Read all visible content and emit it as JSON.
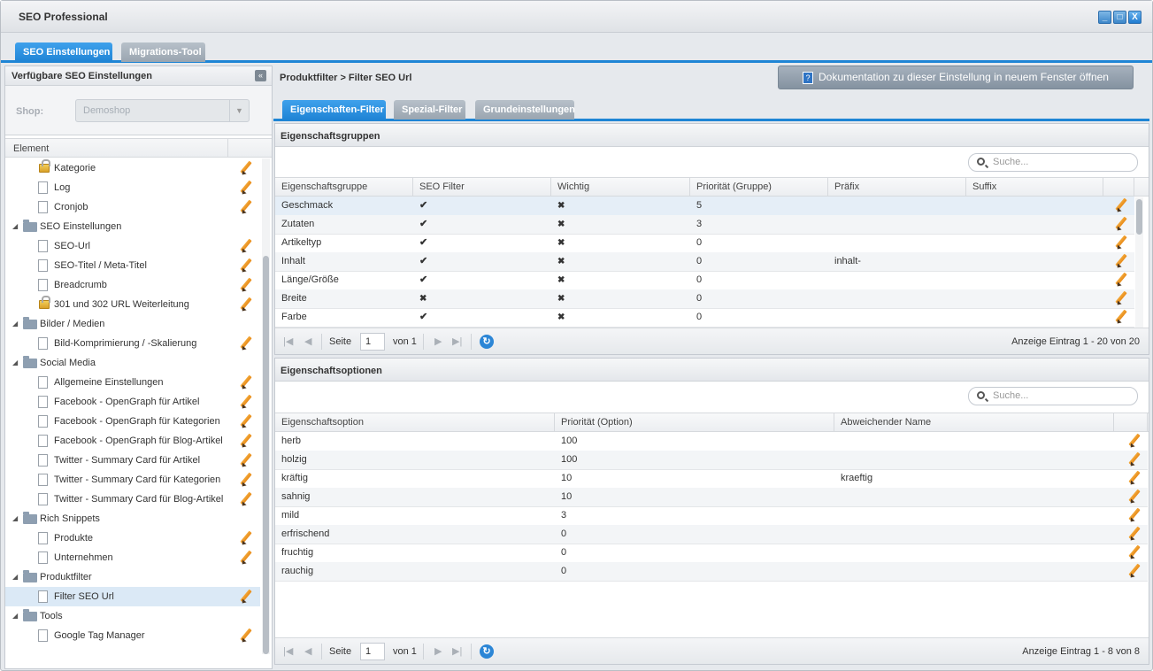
{
  "window": {
    "title": "SEO Professional"
  },
  "main_tabs": [
    {
      "label": "SEO Einstellungen",
      "active": true
    },
    {
      "label": "Migrations-Tool",
      "active": false
    }
  ],
  "left_panel": {
    "title": "Verfügbare SEO Einstellungen",
    "shop_label": "Shop:",
    "shop_value": "Demoshop",
    "tree_header": "Element",
    "tree": [
      {
        "label": "Kategorie",
        "type": "lock",
        "level": 1,
        "editable": true
      },
      {
        "label": "Log",
        "type": "doc",
        "level": 1,
        "editable": true
      },
      {
        "label": "Cronjob",
        "type": "doc",
        "level": 1,
        "editable": true
      },
      {
        "label": "SEO Einstellungen",
        "type": "folder",
        "level": 0,
        "editable": false
      },
      {
        "label": "SEO-Url",
        "type": "doc",
        "level": 1,
        "editable": true
      },
      {
        "label": "SEO-Titel / Meta-Titel",
        "type": "doc",
        "level": 1,
        "editable": true
      },
      {
        "label": "Breadcrumb",
        "type": "doc",
        "level": 1,
        "editable": true
      },
      {
        "label": "301 und 302 URL Weiterleitung",
        "type": "lock",
        "level": 1,
        "editable": true
      },
      {
        "label": "Bilder / Medien",
        "type": "folder",
        "level": 0,
        "editable": false
      },
      {
        "label": "Bild-Komprimierung / -Skalierung",
        "type": "doc",
        "level": 1,
        "editable": true
      },
      {
        "label": "Social Media",
        "type": "folder",
        "level": 0,
        "editable": false
      },
      {
        "label": "Allgemeine Einstellungen",
        "type": "doc",
        "level": 1,
        "editable": true
      },
      {
        "label": "Facebook - OpenGraph für Artikel",
        "type": "doc",
        "level": 1,
        "editable": true
      },
      {
        "label": "Facebook - OpenGraph für Kategorien",
        "type": "doc",
        "level": 1,
        "editable": true
      },
      {
        "label": "Facebook - OpenGraph für Blog-Artikel",
        "type": "doc",
        "level": 1,
        "editable": true
      },
      {
        "label": "Twitter - Summary Card für Artikel",
        "type": "doc",
        "level": 1,
        "editable": true
      },
      {
        "label": "Twitter - Summary Card für Kategorien",
        "type": "doc",
        "level": 1,
        "editable": true
      },
      {
        "label": "Twitter - Summary Card für Blog-Artikel",
        "type": "doc",
        "level": 1,
        "editable": true
      },
      {
        "label": "Rich Snippets",
        "type": "folder",
        "level": 0,
        "editable": false
      },
      {
        "label": "Produkte",
        "type": "doc",
        "level": 1,
        "editable": true
      },
      {
        "label": "Unternehmen",
        "type": "doc",
        "level": 1,
        "editable": true
      },
      {
        "label": "Produktfilter",
        "type": "folder",
        "level": 0,
        "editable": false
      },
      {
        "label": "Filter SEO Url",
        "type": "doc",
        "level": 1,
        "editable": true,
        "selected": true
      },
      {
        "label": "Tools",
        "type": "folder",
        "level": 0,
        "editable": false
      },
      {
        "label": "Google Tag Manager",
        "type": "doc",
        "level": 1,
        "editable": true
      }
    ]
  },
  "right_panel": {
    "breadcrumb": "Produktfilter > Filter SEO Url",
    "doc_button": "Dokumentation zu dieser Einstellung in neuem Fenster öffnen",
    "sub_tabs": [
      {
        "label": "Eigenschaften-Filter",
        "active": true
      },
      {
        "label": "Spezial-Filter",
        "active": false
      },
      {
        "label": "Grundeinstellungen",
        "active": false
      }
    ]
  },
  "groups": {
    "title": "Eigenschaftsgruppen",
    "search_placeholder": "Suche...",
    "columns": [
      "Eigenschaftsgruppe",
      "SEO Filter",
      "Wichtig",
      "Priorität (Gruppe)",
      "Präfix",
      "Suffix"
    ],
    "rows": [
      {
        "name": "Geschmack",
        "seo": true,
        "wichtig": false,
        "prio": "5",
        "prefix": "",
        "suffix": ""
      },
      {
        "name": "Zutaten",
        "seo": true,
        "wichtig": false,
        "prio": "3",
        "prefix": "",
        "suffix": ""
      },
      {
        "name": "Artikeltyp",
        "seo": true,
        "wichtig": false,
        "prio": "0",
        "prefix": "",
        "suffix": ""
      },
      {
        "name": "Inhalt",
        "seo": true,
        "wichtig": false,
        "prio": "0",
        "prefix": "inhalt-",
        "suffix": ""
      },
      {
        "name": "Länge/Größe",
        "seo": true,
        "wichtig": false,
        "prio": "0",
        "prefix": "",
        "suffix": ""
      },
      {
        "name": "Breite",
        "seo": false,
        "wichtig": false,
        "prio": "0",
        "prefix": "",
        "suffix": ""
      },
      {
        "name": "Farbe",
        "seo": true,
        "wichtig": false,
        "prio": "0",
        "prefix": "",
        "suffix": ""
      }
    ],
    "pager": {
      "page_label": "Seite",
      "page": "1",
      "of_label": "von 1",
      "info": "Anzeige Eintrag 1 - 20 von 20"
    }
  },
  "options": {
    "title": "Eigenschaftsoptionen",
    "search_placeholder": "Suche...",
    "columns": [
      "Eigenschaftsoption",
      "Priorität (Option)",
      "Abweichender Name"
    ],
    "rows": [
      {
        "name": "herb",
        "prio": "100",
        "alt": ""
      },
      {
        "name": "holzig",
        "prio": "100",
        "alt": ""
      },
      {
        "name": "kräftig",
        "prio": "10",
        "alt": "kraeftig"
      },
      {
        "name": "sahnig",
        "prio": "10",
        "alt": ""
      },
      {
        "name": "mild",
        "prio": "3",
        "alt": ""
      },
      {
        "name": "erfrischend",
        "prio": "0",
        "alt": ""
      },
      {
        "name": "fruchtig",
        "prio": "0",
        "alt": ""
      },
      {
        "name": "rauchig",
        "prio": "0",
        "alt": ""
      }
    ],
    "pager": {
      "page_label": "Seite",
      "page": "1",
      "of_label": "von 1",
      "info": "Anzeige Eintrag 1 - 8 von 8"
    }
  },
  "icons": {
    "check": "✔",
    "cross": "✖",
    "refresh": "↻",
    "first": "|◀",
    "prev": "◀",
    "next": "▶",
    "last": "▶|",
    "collapse": "«",
    "minimize": "_",
    "maximize": "□",
    "close": "X",
    "help": "?",
    "dropdown": "▼",
    "tree_expand": "◢"
  },
  "colors": {
    "accent": "#1f85d5",
    "check": "#3aa33a",
    "cross": "#d13b3b",
    "pencil": "#e88a17"
  }
}
